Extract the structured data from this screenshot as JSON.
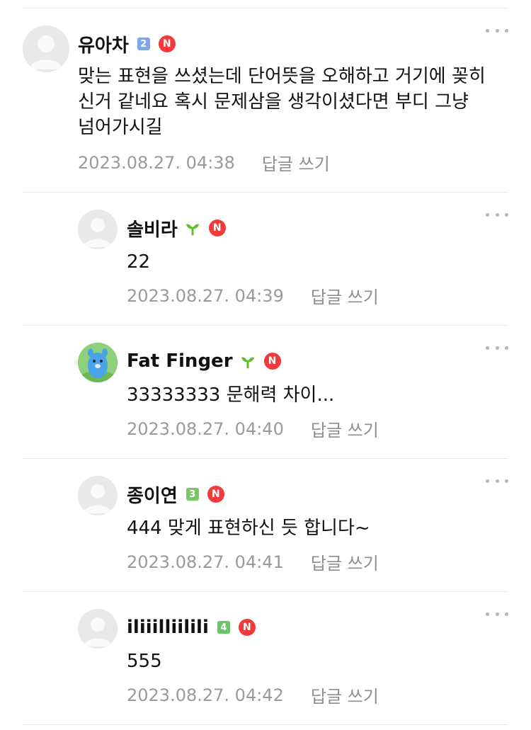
{
  "comments": [
    {
      "nickname": "유아차",
      "level_badge": "2",
      "level_color": "#7fa6e8",
      "badge_n": "N",
      "text": "맞는 표현을 쓰셨는데 단어뜻을 오해하고 거기에 꽂히신거 같네요 혹시 문제삼을 생각이셨다면 부디 그냥 넘어가시길",
      "timestamp": "2023.08.27. 04:38",
      "reply_label": "답글 쓰기",
      "avatar": "default"
    },
    {
      "nickname": "솔비라",
      "level_badge": "sprout",
      "badge_n": "N",
      "text": "22",
      "timestamp": "2023.08.27. 04:39",
      "reply_label": "답글 쓰기",
      "avatar": "default"
    },
    {
      "nickname": "Fat Finger",
      "level_badge": "sprout",
      "badge_n": "N",
      "text": "33333333 문해력 차이...",
      "timestamp": "2023.08.27. 04:40",
      "reply_label": "답글 쓰기",
      "avatar": "blue-character"
    },
    {
      "nickname": "종이연",
      "level_badge": "3",
      "level_color": "#7cc46a",
      "badge_n": "N",
      "text": "444 맞게 표현하신 듯 합니다~",
      "timestamp": "2023.08.27. 04:41",
      "reply_label": "답글 쓰기",
      "avatar": "default"
    },
    {
      "nickname": "iliiilliilili",
      "level_badge": "4",
      "level_color": "#6cc46a",
      "badge_n": "N",
      "text": "555",
      "timestamp": "2023.08.27. 04:42",
      "reply_label": "답글 쓰기",
      "avatar": "default"
    }
  ],
  "colors": {
    "badge_n": "#f23a3a",
    "sprout": "#5cbf2a",
    "meta_text": "#9a9a9a"
  }
}
